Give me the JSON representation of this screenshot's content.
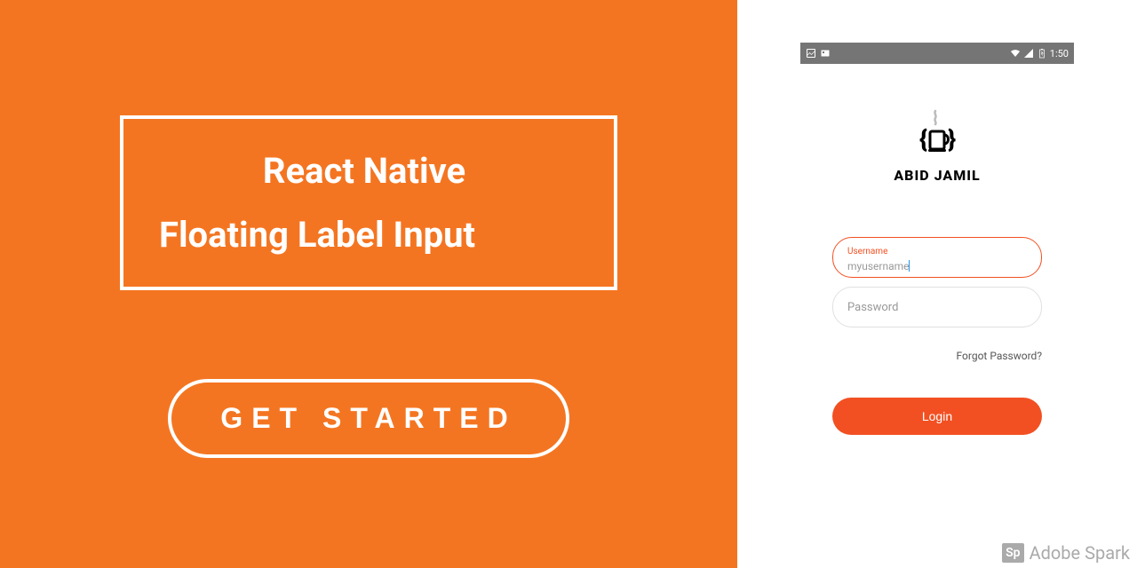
{
  "left": {
    "title_line1": "React Native",
    "title_line2": "Floating Label Input",
    "cta": "GET STARTED"
  },
  "phone": {
    "status": {
      "time": "1:50"
    },
    "logo_text": "ABID JAMIL",
    "form": {
      "username_label": "Username",
      "username_value": "myusername",
      "password_placeholder": "Password",
      "forgot": "Forgot Password?",
      "login": "Login"
    }
  },
  "watermark": {
    "badge": "Sp",
    "text": "Adobe Spark"
  }
}
